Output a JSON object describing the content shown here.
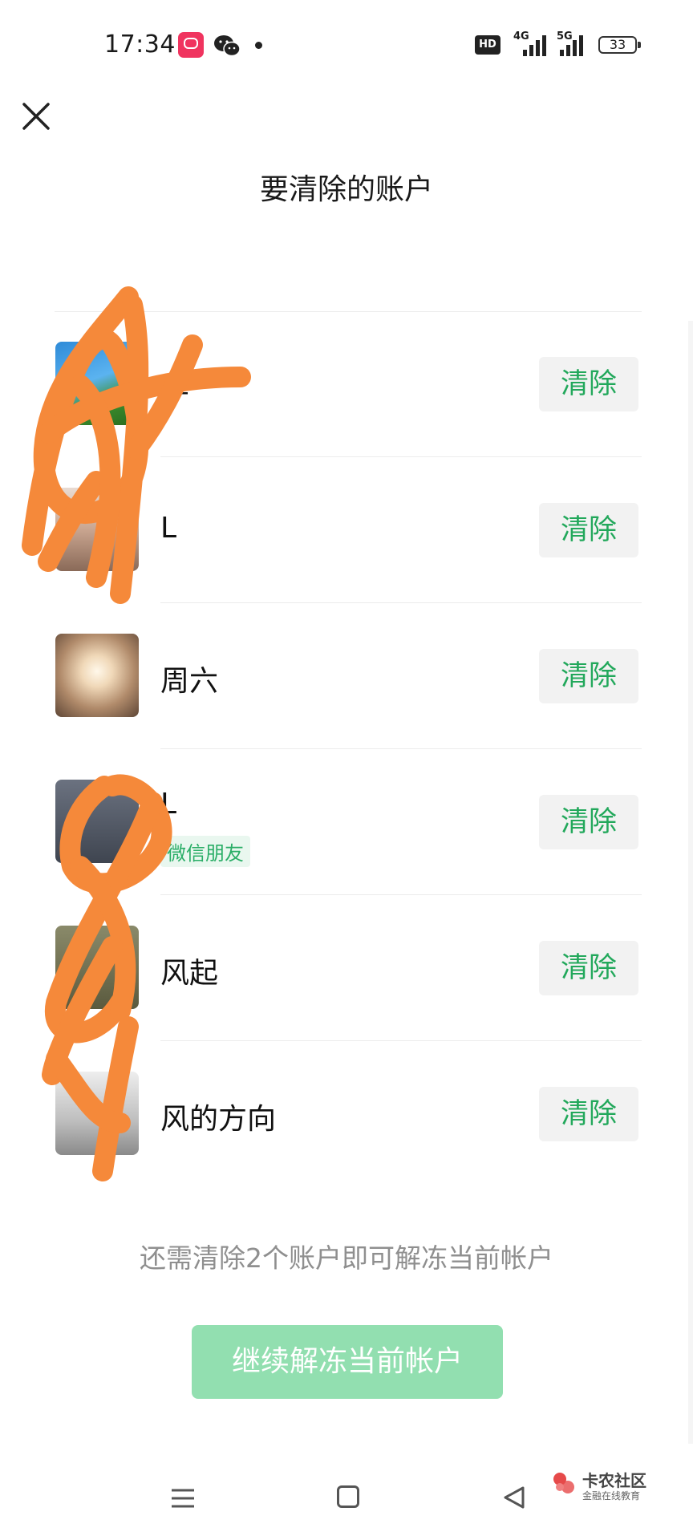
{
  "status_bar": {
    "time": "17:34",
    "hd_badge": "HD",
    "signal1_label": "4G",
    "signal2_label": "5G",
    "battery": "33"
  },
  "header": {
    "title": "要清除的账户"
  },
  "accounts": [
    {
      "name": "李",
      "clear_label": "清除",
      "tag": ""
    },
    {
      "name": "L",
      "clear_label": "清除",
      "tag": ""
    },
    {
      "name": "周六",
      "clear_label": "清除",
      "tag": ""
    },
    {
      "name": "L",
      "clear_label": "清除",
      "tag": "微信朋友"
    },
    {
      "name": "风起",
      "clear_label": "清除",
      "tag": ""
    },
    {
      "name": "风的方向",
      "clear_label": "清除",
      "tag": ""
    }
  ],
  "footer": {
    "hint": "还需清除2个账户即可解冻当前帐户",
    "continue_label": "继续解冻当前帐户"
  },
  "watermark": {
    "title": "卡农社区",
    "subtitle": "金融在线教育"
  },
  "colors": {
    "accent_green": "#22a85b",
    "disabled_button": "#92dfb0",
    "scribble": "#f5893a"
  }
}
